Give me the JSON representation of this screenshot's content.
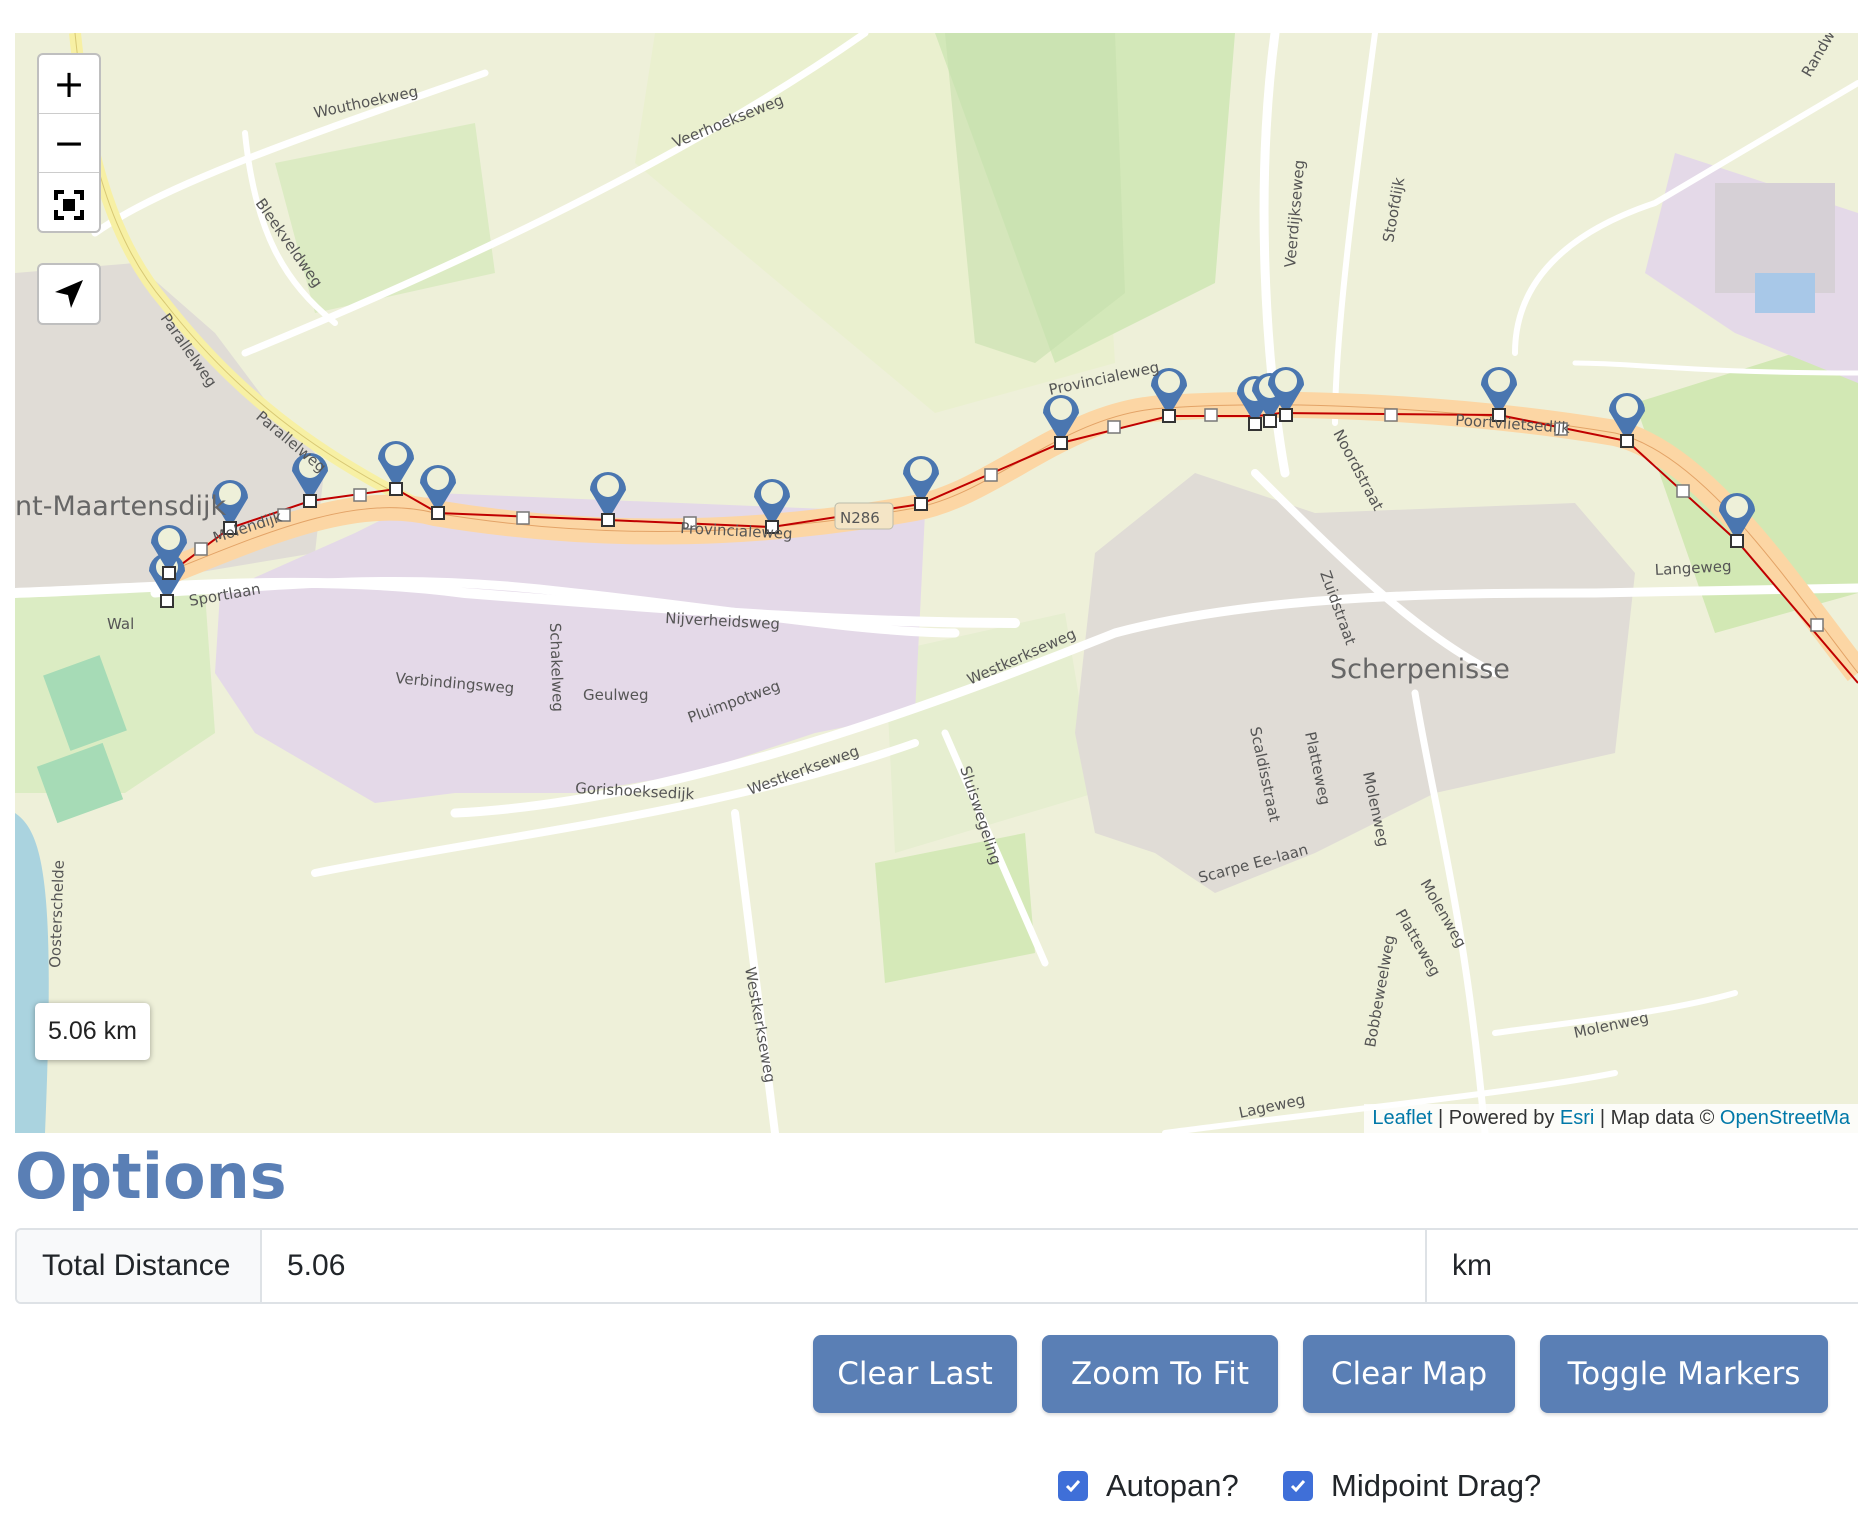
{
  "map": {
    "zoom_in_label": "+",
    "zoom_out_label": "−",
    "distance_readout": "5.06 km",
    "attribution": {
      "leaflet": "Leaflet",
      "powered_by": " | Powered by ",
      "esri": "Esri",
      "map_data": " | Map data © ",
      "osm": "OpenStreetMa"
    },
    "labels": {
      "town_left": "nt-Maartensdijk",
      "town_right": "Scherpenisse",
      "provincialeweg": "Provincialeweg",
      "n286": "N286",
      "provincialeweg_small": "Provincialeweg",
      "poortvlietsedijk": "Poortvlietsedijk",
      "langeweg": "Langeweg",
      "sportlaan": "Sportlaan",
      "wal": "Wal",
      "molendijk": "Molendijk",
      "nijverheidsweg": "Nijverheidsweg",
      "verbindingsweg": "Verbindingsweg",
      "schakelweg": "Schakelweg",
      "geulweg": "Geulweg",
      "pluimpotweg": "Pluimpotweg",
      "gorishoeksedijk": "Gorishoeksedijk",
      "westkerkseweg_1": "Westkerkseweg",
      "westkerkseweg_2": "Westkerkseweg",
      "westkerkseweg_3": "Westkerkseweg",
      "sluisweg": "Sluiswegeling",
      "wouthoekweg": "Wouthoekweg",
      "veerhoekseweg": "Veerhoekseweg",
      "bleekveldweg": "Bleekveldweg",
      "parallelweg_1": "Parallelweg",
      "parallelweg_2": "Parallelweg",
      "veerdijkseweg": "Veerdijkseweg",
      "stoofdijk": "Stoofdijk",
      "noordstraat": "Noordstraat",
      "zuidstraat": "Zuidstraat",
      "oosterschelde": "Oosterschelde",
      "scaldisstraat": "Scaldisstraat",
      "platteweg": "Platteweg",
      "molenweg_1": "Molenweg",
      "molenweg_2": "Molenweg",
      "molenweg_3": "Molenweg",
      "scarpe": "Scarpe Ee-laan",
      "platteweg_2": "Platteweg",
      "bobbeweelweg": "Bobbeweelweg",
      "lageweg": "Lageweg",
      "randweg": "Randw"
    }
  },
  "options": {
    "heading": "Options",
    "total_distance_label": "Total Distance",
    "total_distance_value": "5.06",
    "unit": "km"
  },
  "buttons": {
    "clear_last": "Clear Last",
    "zoom_to_fit": "Zoom To Fit",
    "clear_map": "Clear Map",
    "toggle_markers": "Toggle Markers"
  },
  "checkboxes": {
    "autopan": "Autopan?",
    "midpoint_drag": "Midpoint Drag?"
  },
  "colors": {
    "accent": "#5a7fb5",
    "marker": "#4a76b0",
    "route": "#c00000",
    "checkbox": "#3f6fd8"
  }
}
